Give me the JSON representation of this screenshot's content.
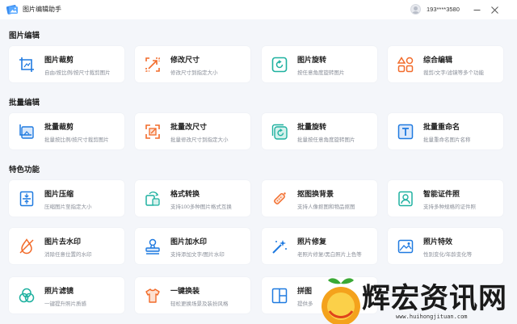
{
  "app": {
    "title": "图片编辑助手"
  },
  "user": {
    "phone": "193****3580"
  },
  "colors": {
    "blue": "#1f7ae0",
    "orange": "#f26b2a",
    "teal": "#1fb1a0",
    "green": "#44b05a"
  },
  "sections": [
    {
      "title": "图片编辑"
    },
    {
      "title": "批量编辑"
    },
    {
      "title": "特色功能"
    }
  ],
  "cards": [
    {
      "title": "图片裁剪",
      "desc": "自由/按比例/按尺寸裁剪图片",
      "icon": "crop-icon"
    },
    {
      "title": "修改尺寸",
      "desc": "修改尺寸到指定大小",
      "icon": "resize-icon"
    },
    {
      "title": "图片旋转",
      "desc": "按任意角度旋转图片",
      "icon": "rotate-icon"
    },
    {
      "title": "综合编辑",
      "desc": "裁剪/文字/滤镜等多个功能",
      "icon": "edit-shapes-icon"
    },
    {
      "title": "批量裁剪",
      "desc": "批量按比例/按尺寸裁剪图片",
      "icon": "batch-crop-icon"
    },
    {
      "title": "批量改尺寸",
      "desc": "批量修改尺寸到指定大小",
      "icon": "batch-resize-icon"
    },
    {
      "title": "批量旋转",
      "desc": "批量按任意角度旋转图片",
      "icon": "batch-rotate-icon"
    },
    {
      "title": "批量重命名",
      "desc": "批量重命名图片名称",
      "icon": "rename-icon"
    },
    {
      "title": "图片压缩",
      "desc": "压缩图片至指定大小",
      "icon": "compress-icon"
    },
    {
      "title": "格式转换",
      "desc": "支持100多种图片格式互换",
      "icon": "convert-icon"
    },
    {
      "title": "抠图换背景",
      "desc": "支持人像抠图和物品抠图",
      "icon": "cutout-icon"
    },
    {
      "title": "智能证件照",
      "desc": "支持多种规格的证件照",
      "icon": "id-photo-icon"
    },
    {
      "title": "图片去水印",
      "desc": "消除任意位置的水印",
      "icon": "remove-watermark-icon"
    },
    {
      "title": "图片加水印",
      "desc": "支持添加文字/图片水印",
      "icon": "add-watermark-icon"
    },
    {
      "title": "照片修复",
      "desc": "老照片修复/黑白照片上色等",
      "icon": "magic-wand-icon"
    },
    {
      "title": "照片特效",
      "desc": "性别变化/年龄变化等",
      "icon": "photo-effect-icon"
    },
    {
      "title": "照片滤镜",
      "desc": "一键提升照片质感",
      "icon": "filter-icon"
    },
    {
      "title": "一键换装",
      "desc": "轻松更换场景及装扮风格",
      "icon": "clothes-icon"
    },
    {
      "title": "拼图",
      "desc": "提供多",
      "icon": "collage-icon"
    }
  ],
  "watermark": {
    "text": "辉宏资讯网",
    "url": "www.huihongjituan.com"
  }
}
